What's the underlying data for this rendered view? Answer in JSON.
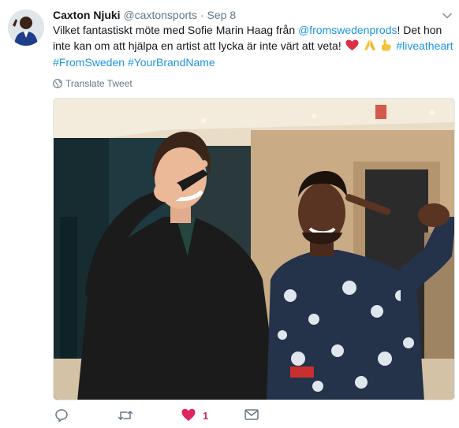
{
  "author": {
    "name": "Caxton Njuki",
    "handle": "@caxtonsports",
    "separator": "·",
    "date": "Sep 8"
  },
  "tweet": {
    "line1": "Vilket fantastiskt möte med Sofie Marin Haag från ",
    "mention": "@fromswedenprods",
    "line1_tail": "! Det hon",
    "line2": "inte kan om att hjälpa en artist att lycka är inte värt att veta! ",
    "hashtag1": "#liveatheart",
    "hashtag2": "#FromSweden",
    "hashtag3": "#YourBrandName"
  },
  "translate": {
    "label": "Translate Tweet"
  },
  "actions": {
    "like_count": "1"
  },
  "icons": {
    "caret": "chevron-down-icon",
    "globe": "globe-icon",
    "reply": "reply-icon",
    "retweet": "retweet-icon",
    "like": "heart-icon",
    "dm": "envelope-icon"
  },
  "colors": {
    "link": "#1b95e0",
    "secondary_text": "#657786",
    "like": "#e0245e"
  }
}
